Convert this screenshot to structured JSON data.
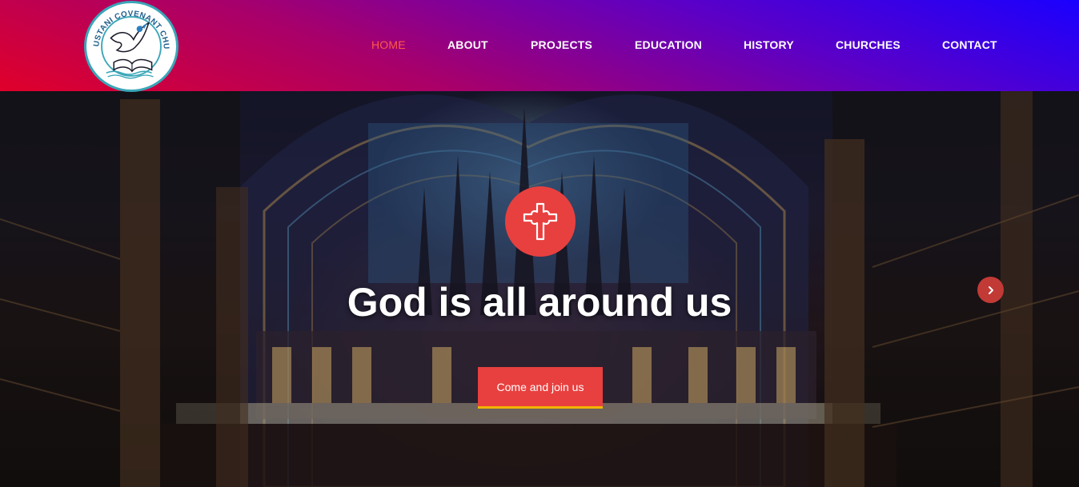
{
  "brand": {
    "logo_text": "HINDUSTANI COVENANT CHURCH"
  },
  "nav": {
    "items": [
      {
        "label": "HOME",
        "active": true
      },
      {
        "label": "ABOUT",
        "active": false
      },
      {
        "label": "PROJECTS",
        "active": false
      },
      {
        "label": "EDUCATION",
        "active": false
      },
      {
        "label": "HISTORY",
        "active": false
      },
      {
        "label": "CHURCHES",
        "active": false
      },
      {
        "label": "CONTACT",
        "active": false
      }
    ]
  },
  "hero": {
    "headline": "God is all around us",
    "cta_label": "Come and join us",
    "icon": "cross-icon",
    "next_icon": "chevron-right-icon"
  },
  "colors": {
    "accent": "#e8403f",
    "active_nav": "#ff5a4a",
    "header_gradient_start": "#e0002a",
    "header_gradient_end": "#1a00ff",
    "cta_underline": "#f2b400"
  }
}
